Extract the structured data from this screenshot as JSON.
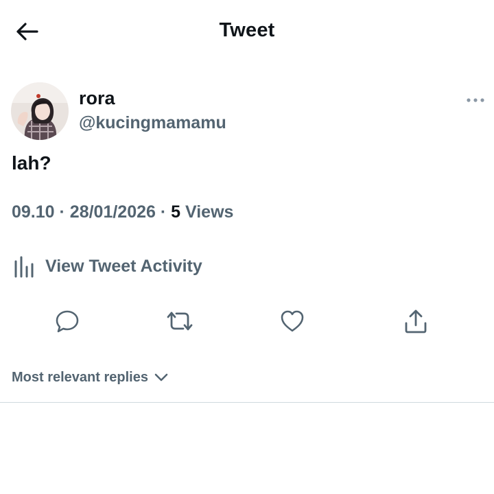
{
  "header": {
    "title": "Tweet",
    "back_icon": "arrow-left-icon"
  },
  "tweet": {
    "author": {
      "display_name": "rora",
      "handle": "@kucingmamamu"
    },
    "more_icon": "more-horizontal-icon",
    "text": "lah?",
    "time": "09.10",
    "separator": "·",
    "date": "28/01/2026",
    "views_count": "5",
    "views_label": "Views"
  },
  "activity": {
    "label": "View Tweet Activity",
    "icon": "analytics-icon"
  },
  "actions": [
    {
      "name": "reply",
      "icon": "reply-icon"
    },
    {
      "name": "retweet",
      "icon": "retweet-icon"
    },
    {
      "name": "like",
      "icon": "heart-icon"
    },
    {
      "name": "share",
      "icon": "share-icon"
    }
  ],
  "replies": {
    "sort_label": "Most relevant replies",
    "sort_icon": "chevron-down-icon"
  },
  "colors": {
    "primary_text": "#0f1419",
    "secondary_text": "#536471",
    "divider": "#cfd9de"
  }
}
